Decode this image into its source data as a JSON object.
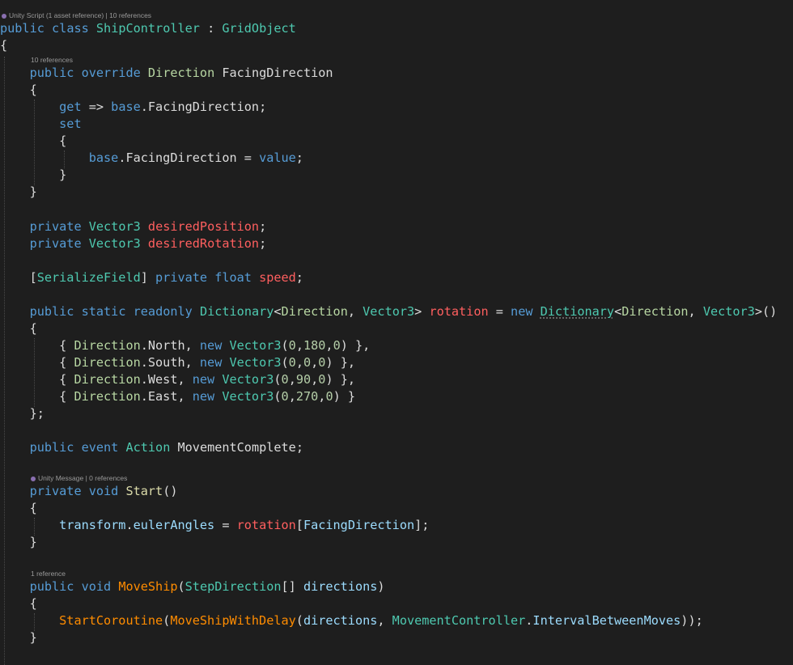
{
  "code_lens": {
    "class_info": "Unity Script (1 asset reference) | 10 references",
    "property_refs": "10 references",
    "start_info": "Unity Message | 0 references",
    "moveship_refs": "1 reference"
  },
  "keywords": {
    "public": "public",
    "class": "class",
    "override": "override",
    "private": "private",
    "static": "static",
    "readonly": "readonly",
    "new": "new",
    "event": "event",
    "void": "void",
    "get": "get",
    "set": "set",
    "base": "base",
    "value": "value",
    "float": "float"
  },
  "types": {
    "ShipController": "ShipController",
    "GridObject": "GridObject",
    "Direction": "Direction",
    "Vector3": "Vector3",
    "SerializeField": "SerializeField",
    "Dictionary": "Dictionary",
    "Action": "Action",
    "StepDirection": "StepDirection",
    "MovementController": "MovementController"
  },
  "members": {
    "FacingDirection": "FacingDirection",
    "desiredPosition": "desiredPosition",
    "desiredRotation": "desiredRotation",
    "speed": "speed",
    "rotation": "rotation",
    "North": "North",
    "South": "South",
    "West": "West",
    "East": "East",
    "MovementComplete": "MovementComplete",
    "Start": "Start",
    "transform": "transform",
    "eulerAngles": "eulerAngles",
    "MoveShip": "MoveShip",
    "directions": "directions",
    "StartCoroutine": "StartCoroutine",
    "MoveShipWithDelay": "MoveShipWithDelay",
    "IntervalBetweenMoves": "IntervalBetweenMoves"
  },
  "numbers": {
    "n0": "0",
    "n90": "90",
    "n180": "180",
    "n270": "270"
  },
  "theme": {
    "background": "#1e1e1e",
    "keyword": "#569cd6",
    "type": "#4ec9b0",
    "enum_type": "#b8d7a3",
    "method": "#dcdcaa",
    "parameter": "#9cdcfe",
    "field": "#ff5f5f",
    "unity_message": "#ff8c00",
    "number": "#b5cea8",
    "plain": "#dcdcdc"
  }
}
